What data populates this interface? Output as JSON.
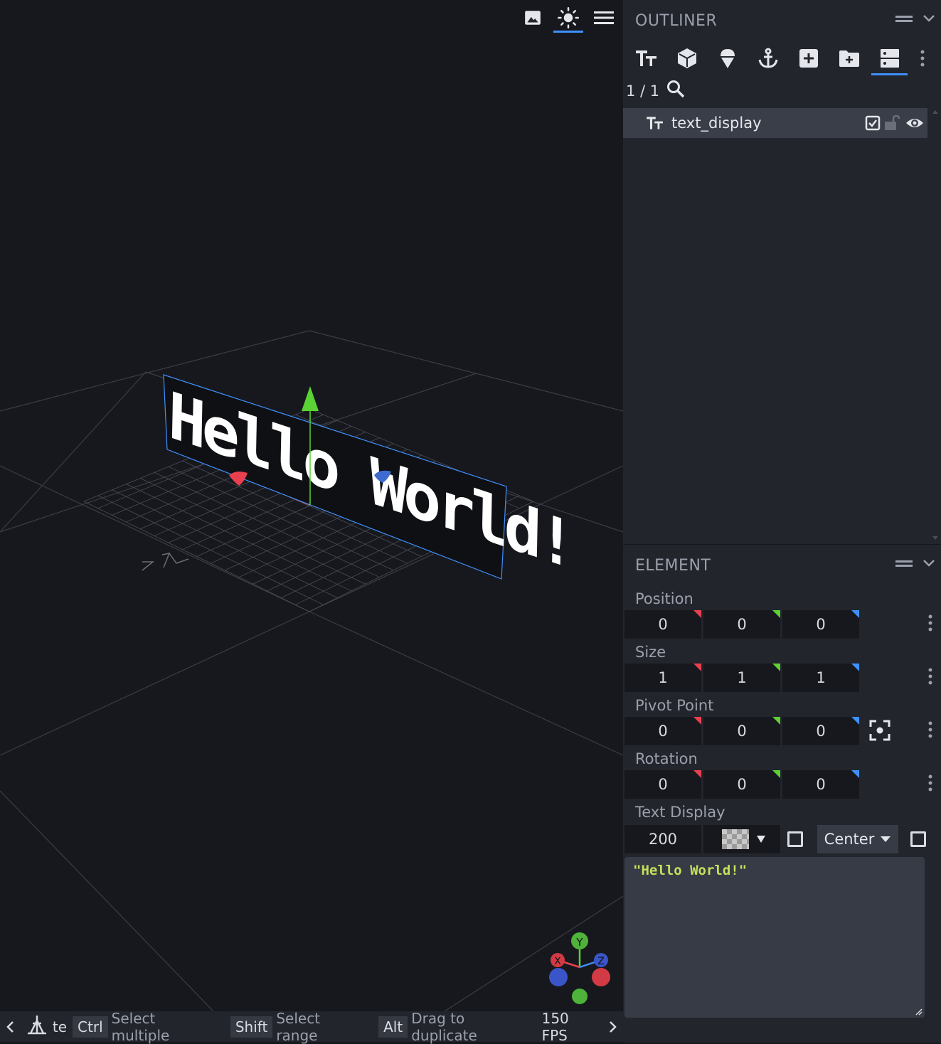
{
  "viewport": {
    "tools": [
      {
        "icon": "image-icon",
        "active": false
      },
      {
        "icon": "sun-icon",
        "active": true
      },
      {
        "icon": "menu-icon",
        "active": false
      }
    ],
    "text_element": "Hello World!",
    "gizmo_axes": {
      "x": "X",
      "y": "Y",
      "z": "Z"
    },
    "colors": {
      "x": "#e8404e",
      "y": "#5ad233",
      "z": "#3e90ff",
      "selection": "#3e90ff"
    }
  },
  "statusbar": {
    "partial_text": "te",
    "hints": [
      {
        "key": "Ctrl",
        "desc": "Select multiple"
      },
      {
        "key": "Shift",
        "desc": "Select range"
      },
      {
        "key": "Alt",
        "desc": "Drag to duplicate"
      }
    ],
    "fps": "150 FPS"
  },
  "outliner": {
    "title": "OUTLINER",
    "tools": [
      "text-icon",
      "cube-icon",
      "ice-cream-icon",
      "anchor-icon",
      "add-box-icon",
      "add-folder-icon",
      "storage-icon"
    ],
    "count": "1 / 1",
    "items": [
      {
        "name": "text_display",
        "icon": "text-icon",
        "selected": true,
        "export": true,
        "locked": false,
        "visible": true
      }
    ]
  },
  "element": {
    "title": "ELEMENT",
    "position": {
      "label": "Position",
      "x": "0",
      "y": "0",
      "z": "0"
    },
    "size": {
      "label": "Size",
      "x": "1",
      "y": "1",
      "z": "1"
    },
    "pivot": {
      "label": "Pivot Point",
      "x": "0",
      "y": "0",
      "z": "0"
    },
    "rotation": {
      "label": "Rotation",
      "x": "0",
      "y": "0",
      "z": "0"
    },
    "text_display": {
      "label": "Text Display",
      "line_width": "200",
      "background": "transparent",
      "shadow": false,
      "alignment": "Center",
      "see_through": false,
      "text": "\"Hello World!\""
    }
  }
}
